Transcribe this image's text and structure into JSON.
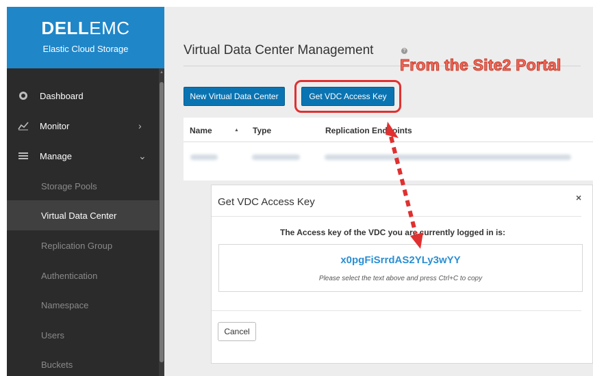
{
  "brand": {
    "logo_left": "D",
    "logo_mid": "ELL",
    "logo_right": "EMC",
    "subtitle": "Elastic Cloud Storage"
  },
  "sidebar": {
    "items": [
      {
        "label": "Dashboard",
        "icon": "dashboard-icon"
      },
      {
        "label": "Monitor",
        "icon": "monitor-chart-icon",
        "chevron": "›"
      },
      {
        "label": "Manage",
        "icon": "manage-list-icon",
        "chevron": "⌄"
      }
    ],
    "sub_items": [
      {
        "label": "Storage Pools"
      },
      {
        "label": "Virtual Data Center",
        "active": true
      },
      {
        "label": "Replication Group"
      },
      {
        "label": "Authentication"
      },
      {
        "label": "Namespace"
      },
      {
        "label": "Users"
      },
      {
        "label": "Buckets"
      }
    ]
  },
  "main": {
    "title": "Virtual Data Center Management",
    "help_icon": "?",
    "new_vdc_button": "New Virtual Data Center",
    "get_key_button": "Get VDC Access Key",
    "annotation": "From the Site2 Portal",
    "table": {
      "columns": [
        "Name",
        "Type",
        "Replication Endpoints"
      ],
      "sort_indicator": "▲"
    }
  },
  "modal": {
    "title": "Get VDC Access Key",
    "close": "×",
    "message": "The Access key of the VDC you are currently logged in is:",
    "key": "x0pgFiSrrdAS2YLy3wYY",
    "hint": "Please select the text above and press Ctrl+C to copy",
    "cancel": "Cancel"
  },
  "colors": {
    "brand": "#1f86c8",
    "primary_button": "#0a74b2",
    "annotation": "#e03030",
    "key_text": "#2a8fd4"
  }
}
